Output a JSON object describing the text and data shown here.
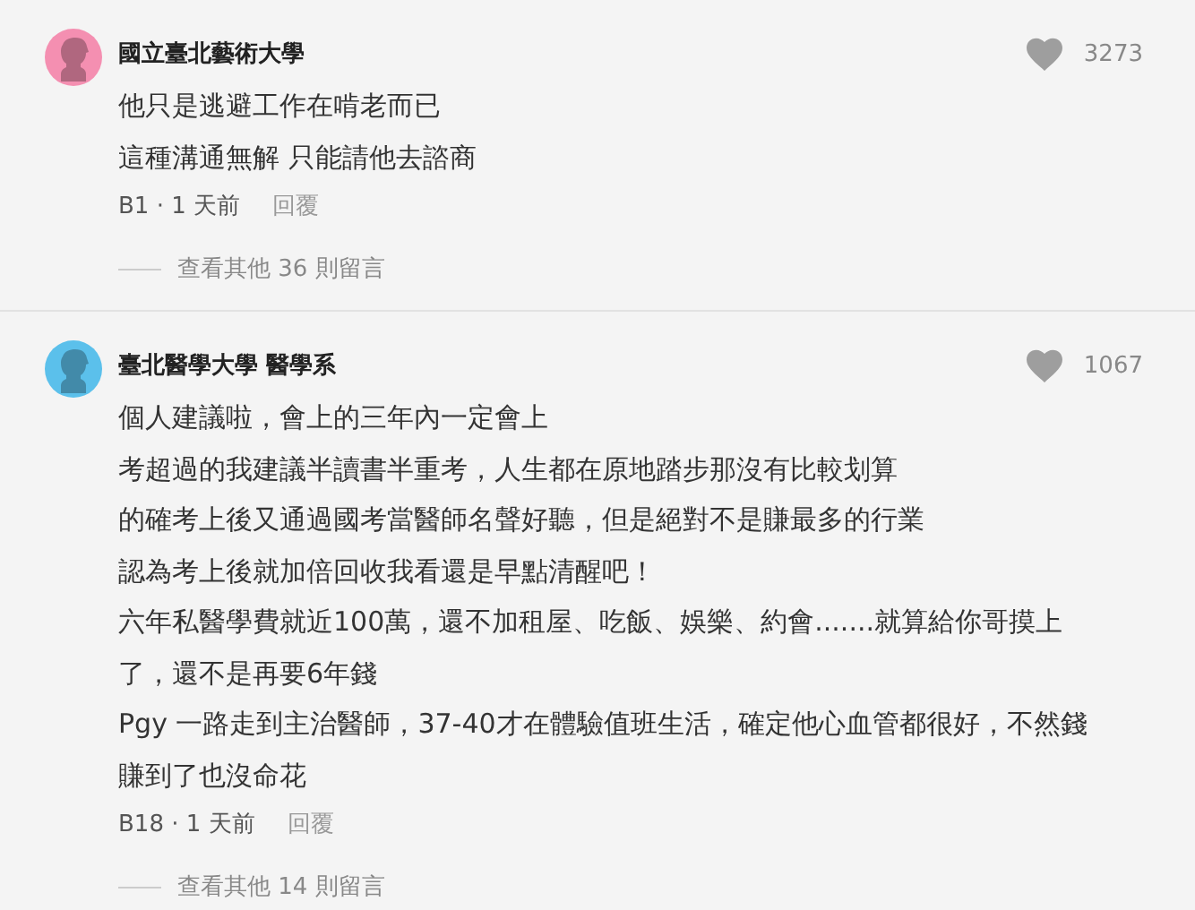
{
  "comments": [
    {
      "author": "國立臺北藝術大學",
      "avatar": {
        "color": "#f48fb1"
      },
      "likes": "3273",
      "lines": [
        "他只是逃避工作在啃老而已",
        "這種溝通無解 只能請他去諮商"
      ],
      "meta": "B1 · 1 天前",
      "reply": "回覆",
      "more": "查看其他 36 則留言"
    },
    {
      "author": "臺北醫學大學 醫學系",
      "avatar": {
        "color": "#5bc0eb"
      },
      "likes": "1067",
      "lines": [
        "個人建議啦，會上的三年內一定會上",
        "考超過的我建議半讀書半重考，人生都在原地踏步那沒有比較划算",
        "的確考上後又通過國考當醫師名聲好聽，但是絕對不是賺最多的行業",
        "認為考上後就加倍回收我看還是早點清醒吧！",
        "六年私醫學費就近100萬，還不加租屋、吃飯、娛樂、約會.......就算給你哥摸上",
        "了，還不是再要6年錢",
        "Pgy 一路走到主治醫師，37-40才在體驗值班生活，確定他心血管都很好，不然錢",
        "賺到了也沒命花"
      ],
      "meta": "B18 · 1 天前",
      "reply": "回覆",
      "more": "查看其他 14 則留言"
    }
  ]
}
